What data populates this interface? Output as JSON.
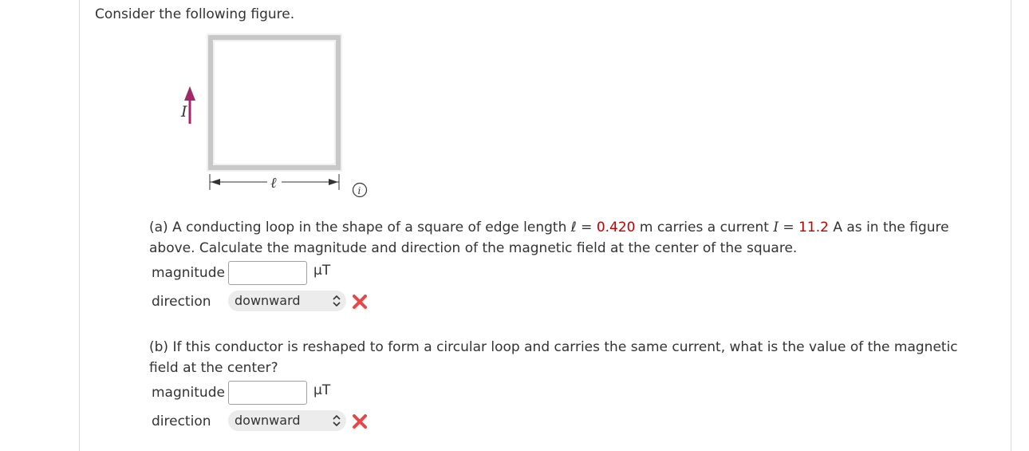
{
  "intro": "Consider the following figure.",
  "figure": {
    "current_label": "I",
    "length_label": "ℓ"
  },
  "part_a": {
    "text_1": "(a) A conducting loop in the shape of a square of edge length ℓ = ",
    "length_value": "0.420",
    "text_2": " m carries a current ",
    "current_symbol": "I",
    "text_3": " = ",
    "current_value": "11.2",
    "text_4": " A as in the figure",
    "text_5": "above. Calculate the magnitude and direction of the magnetic field at the center of the square.",
    "magnitude_label": "magnitude",
    "magnitude_value": "",
    "unit": "μT",
    "direction_label": "direction",
    "direction_value": "downward"
  },
  "part_b": {
    "text_1": "(b) If this conductor is reshaped to form a circular loop and carries the same current, what is the value of the magnetic",
    "text_2": "field at the center?",
    "magnitude_label": "magnitude",
    "magnitude_value": "",
    "unit": "μT",
    "direction_label": "direction",
    "direction_value": "downward"
  },
  "colors": {
    "given_value": "#c00000",
    "incorrect": "#e8474a",
    "arrow": "#a3286a"
  }
}
